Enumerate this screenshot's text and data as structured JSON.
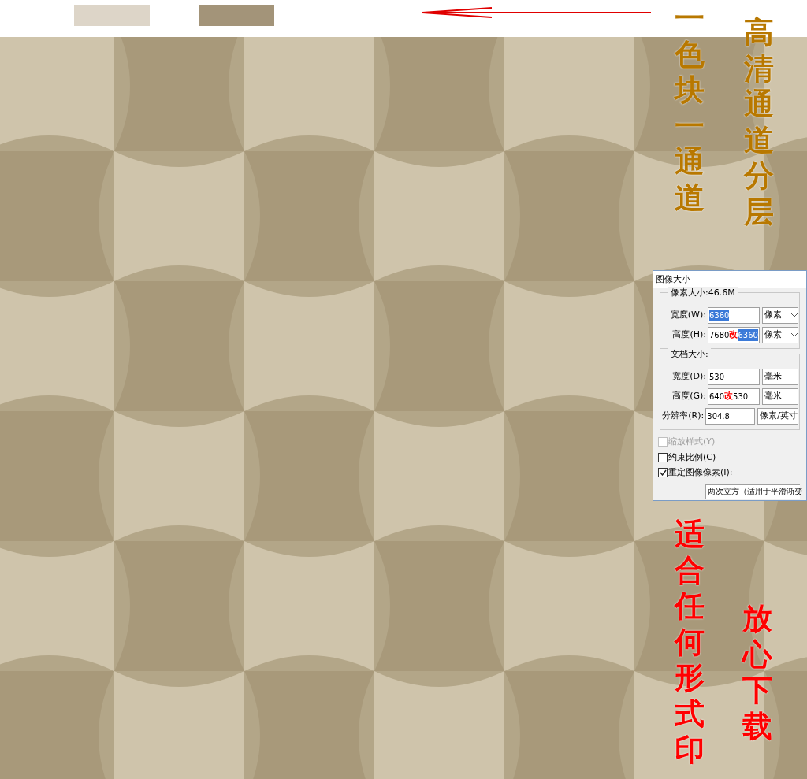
{
  "swatches": [
    {
      "color": "#ddd5c8"
    },
    {
      "color": "#a39479"
    }
  ],
  "captions": [
    {
      "text": "一色块一通道",
      "color": "#b87800"
    },
    {
      "text": "高清通道分层",
      "color": "#b87800"
    },
    {
      "text": "适合任何形式印",
      "color": "#ff0000"
    },
    {
      "text": "放心下载",
      "color": "#ff0000"
    }
  ],
  "dialog": {
    "title": "图像大小",
    "groups": [
      {
        "legend": "像素大小:46.6M",
        "rows": [
          {
            "label": "宽度(W):",
            "value": "6360",
            "highlighted": true,
            "unit": "像素"
          },
          {
            "label": "高度(H):",
            "value": "7680",
            "correction": "改",
            "corrected_value": "6360",
            "highlighted": true,
            "unit": "像素"
          }
        ]
      },
      {
        "legend": "文档大小:",
        "rows": [
          {
            "label": "宽度(D):",
            "value": "530",
            "highlighted": false,
            "unit": "毫米"
          },
          {
            "label": "高度(G):",
            "value": "640",
            "correction": "改",
            "corrected_value": "530",
            "highlighted": false,
            "unit": "毫米"
          },
          {
            "label": "分辨率(R):",
            "value": "304.8",
            "highlighted": false,
            "unit": "像素/英寸"
          }
        ]
      }
    ],
    "options": [
      {
        "label": "缩放样式(Y)",
        "checked": false,
        "disabled": true
      },
      {
        "label": "约束比例(C)",
        "checked": false,
        "disabled": false
      },
      {
        "label": "重定图像像素(I):",
        "checked": true,
        "disabled": false
      }
    ],
    "resample_method": "两次立方（适用于平滑渐变"
  }
}
